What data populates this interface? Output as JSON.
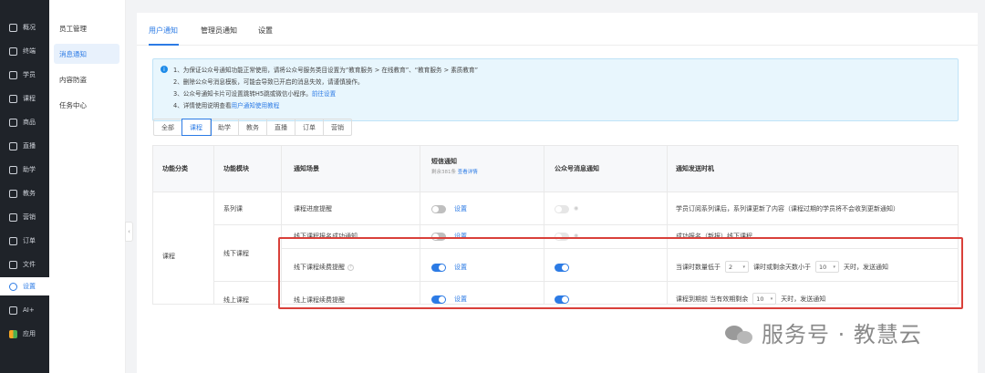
{
  "nav": {
    "items": [
      {
        "label": "概况",
        "icon": "grid-icon"
      },
      {
        "label": "终端",
        "icon": "monitor-icon"
      },
      {
        "label": "学员",
        "icon": "users-icon"
      },
      {
        "label": "课程",
        "icon": "course-icon"
      },
      {
        "label": "商品",
        "icon": "bag-icon"
      },
      {
        "label": "直播",
        "icon": "live-icon"
      },
      {
        "label": "助学",
        "icon": "study-icon"
      },
      {
        "label": "教务",
        "icon": "book-icon"
      },
      {
        "label": "营销",
        "icon": "marketing-icon"
      },
      {
        "label": "订单",
        "icon": "order-icon"
      },
      {
        "label": "文件",
        "icon": "folder-icon"
      },
      {
        "label": "设置",
        "icon": "settings-icon"
      },
      {
        "label": "AI+",
        "icon": "ai-icon"
      },
      {
        "label": "应用",
        "icon": "apps-icon"
      }
    ]
  },
  "subnav": {
    "items": [
      "员工管理",
      "消息通知",
      "内容防盗",
      "任务中心"
    ]
  },
  "tabs": [
    "用户通知",
    "管理员通知",
    "设置"
  ],
  "notice": {
    "line1": "1、为保证公众号通知功能正常使用，请将公众号服务类目设置为“教育服务 > 在线教育”、“教育服务 > 素质教育”",
    "line2": "2、删除公众号消息模板，可能会导致已开启的消息失效，请谨慎操作。",
    "line3": "3、公众号通知卡片可设置跳转H5跳或微信小程序。",
    "line3_link": "前往设置",
    "line4": "4、详情使用说明查看",
    "line4_link": "用户通知使用教程"
  },
  "filters": [
    "全部",
    "课程",
    "助学",
    "教务",
    "直播",
    "订单",
    "营销"
  ],
  "table": {
    "headers": {
      "category": "功能分类",
      "module": "功能模块",
      "scene": "通知场景",
      "sms": "短信通知",
      "sms_sub": "剩余381条",
      "sms_sub_link": "查看详情",
      "wechat": "公众号消息通知",
      "timing": "通知发送时机"
    },
    "category": "课程",
    "modules": [
      "系列课",
      "线下课程",
      "线上课程"
    ],
    "rows": [
      {
        "scene": "课程进度提醒",
        "sms_link": "设置",
        "timing": "学员订阅系列课后，系列课更新了内容（课程过期的学员将不会收到更新通知）"
      },
      {
        "scene": "线下课程报名成功通知",
        "sms_link": "设置",
        "timing": "成功报名（新报）线下课程"
      },
      {
        "scene": "线下课程续费提醒",
        "sms_link": "设置",
        "timing_a": "当课时数量低于",
        "timing_v1": "2",
        "timing_b": "课时或剩余天数小于",
        "timing_v2": "10",
        "timing_c": "天时，发送通知"
      },
      {
        "scene": "线上课程续费提醒",
        "sms_link": "设置",
        "timing_a": "课程到期前 当有效期剩余",
        "timing_v1": "10",
        "timing_c": "天时，发送通知"
      }
    ]
  },
  "watermark": "服务号 · 教慧云",
  "colors": {
    "accent": "#2c7be5",
    "nav_bg": "#1f2329",
    "highlight": "#d9403a"
  }
}
